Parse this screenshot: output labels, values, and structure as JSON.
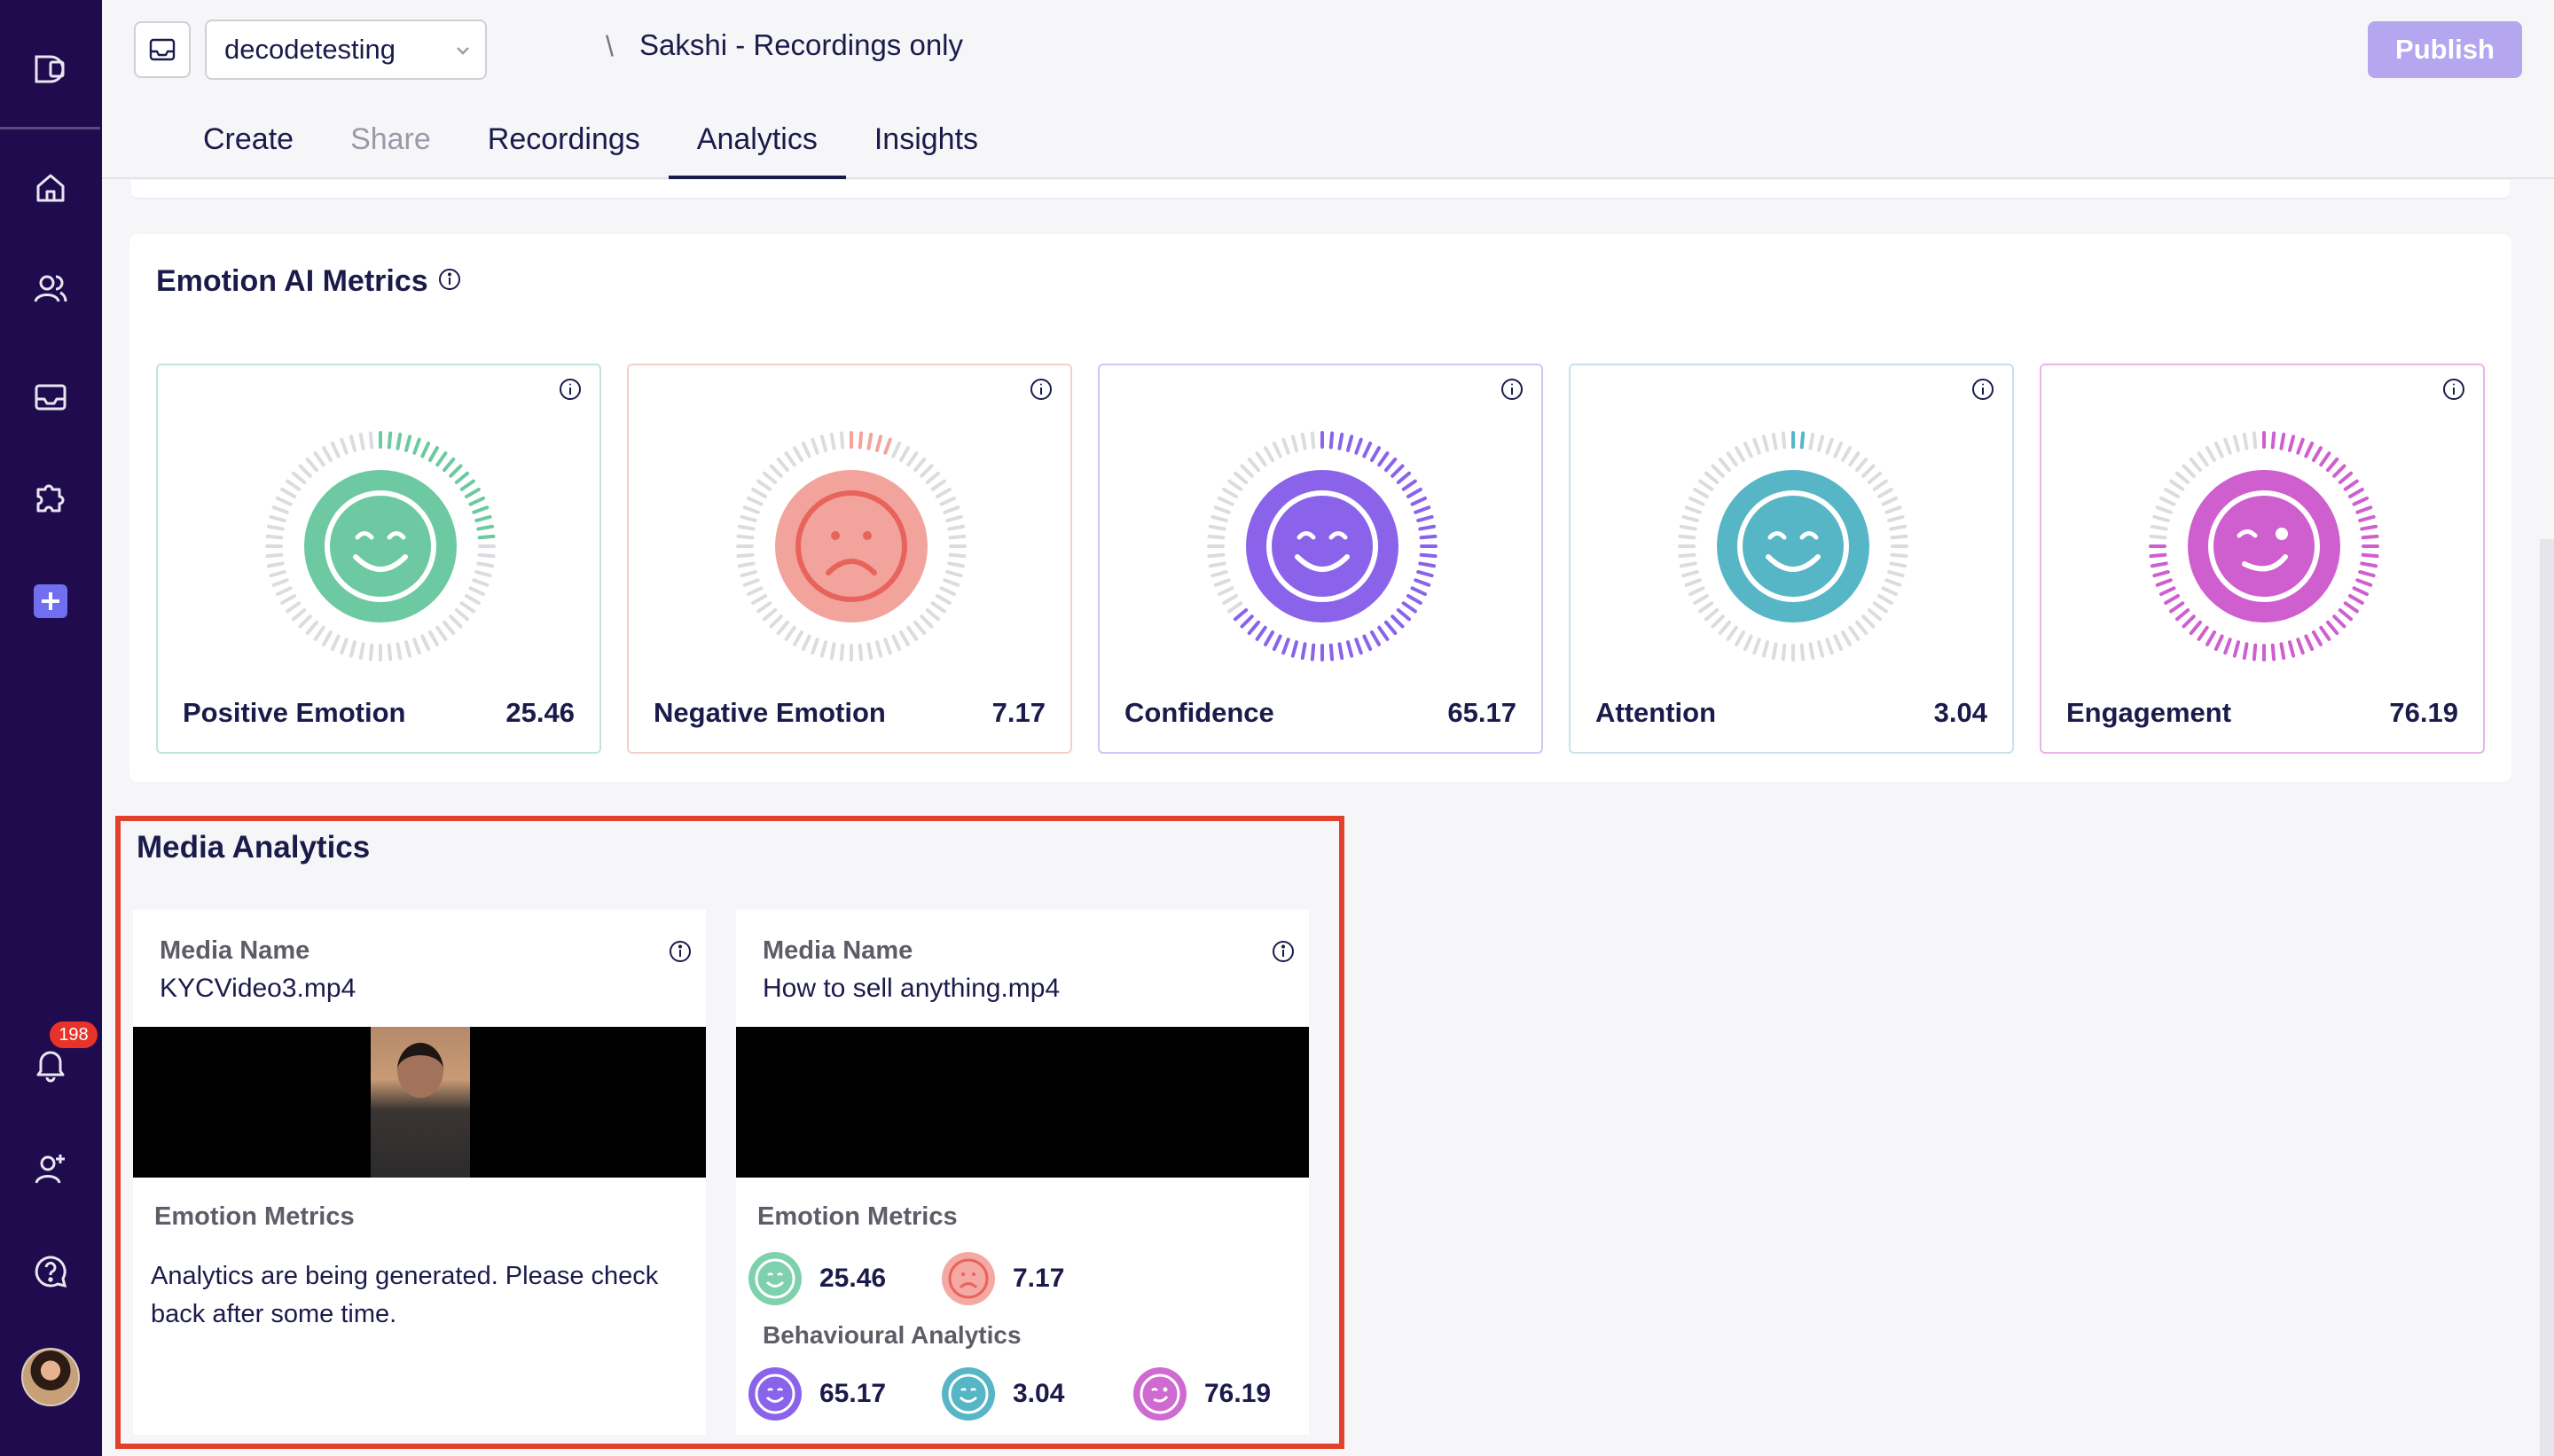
{
  "sidebar": {
    "notification_count": "198",
    "items": [
      {
        "name": "logo-icon"
      },
      {
        "name": "home-icon"
      },
      {
        "name": "users-icon"
      },
      {
        "name": "inbox-icon"
      },
      {
        "name": "puzzle-icon"
      },
      {
        "name": "add-icon"
      },
      {
        "name": "bell-icon"
      },
      {
        "name": "add-user-icon"
      },
      {
        "name": "help-icon"
      }
    ]
  },
  "header": {
    "workspace": "decodetesting",
    "separator": "\\",
    "project_title": "Sakshi - Recordings only",
    "publish_label": "Publish",
    "tabs": [
      {
        "label": "Create",
        "state": "normal"
      },
      {
        "label": "Share",
        "state": "disabled"
      },
      {
        "label": "Recordings",
        "state": "normal"
      },
      {
        "label": "Analytics",
        "state": "active"
      },
      {
        "label": "Insights",
        "state": "normal"
      }
    ]
  },
  "emotion_metrics": {
    "title": "Emotion AI Metrics",
    "cards": [
      {
        "name": "Positive Emotion",
        "value": "25.46",
        "fraction": 0.2546,
        "color": "#6cc9a1",
        "border": "#bfe6d6",
        "face": "smile"
      },
      {
        "name": "Negative Emotion",
        "value": "7.17",
        "fraction": 0.0717,
        "color": "#f2a39c",
        "border": "#f4d0cc",
        "face": "frown"
      },
      {
        "name": "Confidence",
        "value": "65.17",
        "fraction": 0.6517,
        "color": "#8a63ea",
        "border": "#d2c5f4",
        "face": "smile"
      },
      {
        "name": "Attention",
        "value": "3.04",
        "fraction": 0.0304,
        "color": "#56b6c6",
        "border": "#c6e4ea",
        "face": "smile"
      },
      {
        "name": "Engagement",
        "value": "76.19",
        "fraction": 0.7619,
        "color": "#cf5fce",
        "border": "#e7b6e6",
        "face": "wink"
      }
    ]
  },
  "media_analytics": {
    "title": "Media Analytics",
    "media": [
      {
        "label": "Media Name",
        "file": "KYCVideo3.mp4",
        "emotion_label": "Emotion Metrics",
        "message": "Analytics are being generated. Please check back after some time."
      },
      {
        "label": "Media Name",
        "file": "How to sell anything.mp4",
        "emotion_label": "Emotion Metrics",
        "behaviour_label": "Behavioural Analytics",
        "emotion_values": [
          "25.46",
          "7.17"
        ],
        "behaviour_values": [
          "65.17",
          "3.04",
          "76.19"
        ]
      }
    ]
  }
}
